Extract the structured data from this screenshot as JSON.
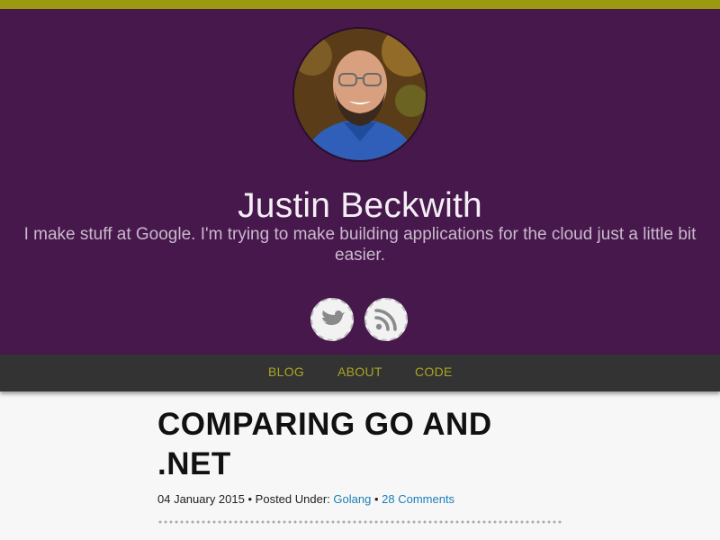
{
  "profile": {
    "name": "Justin Beckwith",
    "tagline": "I make stuff at Google. I'm trying to make building applications for the cloud just a little bit easier."
  },
  "social": [
    {
      "icon": "twitter-bird-icon"
    },
    {
      "icon": "rss-feed-icon"
    }
  ],
  "nav": {
    "blog": "BLOG",
    "about": "ABOUT",
    "code": "CODE"
  },
  "post": {
    "title": "COMPARING GO AND .NET",
    "date": "04 January 2015",
    "posted_under_label": "Posted Under:",
    "category": "Golang",
    "comments": "28 Comments",
    "separator": "•"
  },
  "colors": {
    "top_accent": "#9a9a10",
    "hero_bg": "#47184c",
    "nav_bg": "#333333",
    "nav_link": "#a8a520",
    "link": "#1a7fb8"
  }
}
